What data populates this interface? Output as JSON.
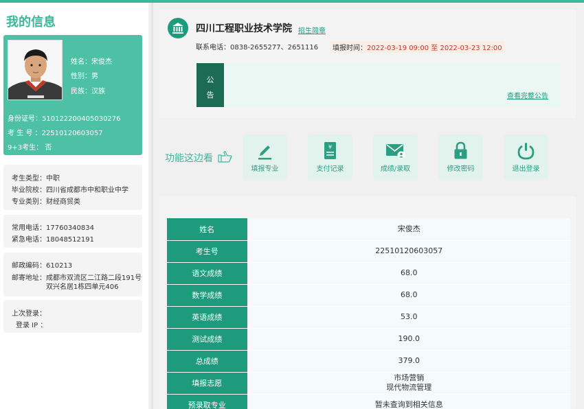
{
  "sidebar": {
    "title": "我的信息",
    "profile": {
      "name": "姓名：宋俊杰",
      "gender": "性别：男",
      "ethnicity": "民族：汉族",
      "id_number": "身份证号：510122200405030276",
      "exam_number": "考 生 号 ：22510120603057",
      "nine_plus_three": "9+3考生： 否"
    },
    "education": {
      "type": "考生类型：中职",
      "school": "毕业院校：四川省成都市中和职业中学",
      "category": "专业类别：财经商贸类"
    },
    "phones": {
      "mobile": "常用电话：17760340834",
      "emergency": "紧急电话：18048512191"
    },
    "address": {
      "postcode": "邮政编码：610213",
      "address_line1": "邮寄地址：成都市双流区二江路二段191号",
      "address_line2": "双兴名居1栋四单元406"
    },
    "login": {
      "last_login": "上次登录：",
      "login_ip": "登录 IP ："
    }
  },
  "school": {
    "name": "四川工程职业技术学院",
    "brochure_link": "招生简章",
    "contact": "联系电话：0838-2655277、2651116",
    "fill_label": "填报时间：",
    "fill_time": "2022-03-19 09:00 至 2022-03-23 12:00",
    "icon": "bank-icon"
  },
  "notice": {
    "label_line1": "公",
    "label_line2": "告",
    "view_all": "查看完整公告"
  },
  "functions": {
    "label": "功能这边看",
    "buttons": [
      {
        "label": "填报专业",
        "icon": "pen-icon"
      },
      {
        "label": "支付记录",
        "icon": "receipt-icon"
      },
      {
        "label": "成绩/录取",
        "icon": "mail-user-icon"
      },
      {
        "label": "修改密码",
        "icon": "lock-icon"
      },
      {
        "label": "退出登录",
        "icon": "power-icon"
      }
    ]
  },
  "scores": [
    {
      "key": "姓名",
      "value": "宋俊杰"
    },
    {
      "key": "考生号",
      "value": "22510120603057"
    },
    {
      "key": "语文成绩",
      "value": "68.0"
    },
    {
      "key": "数学成绩",
      "value": "68.0"
    },
    {
      "key": "英语成绩",
      "value": "53.0"
    },
    {
      "key": "测试成绩",
      "value": "190.0"
    },
    {
      "key": "总成绩",
      "value": "379.0"
    },
    {
      "key": "填报志愿",
      "value": "市场营销",
      "value2": "现代物流管理"
    },
    {
      "key": "预录取专业",
      "value": "暂未查询到相关信息"
    }
  ],
  "colors": {
    "accent": "#3bb79b",
    "dark_accent": "#1e9a7c",
    "notice_dark": "#1e6b55"
  }
}
